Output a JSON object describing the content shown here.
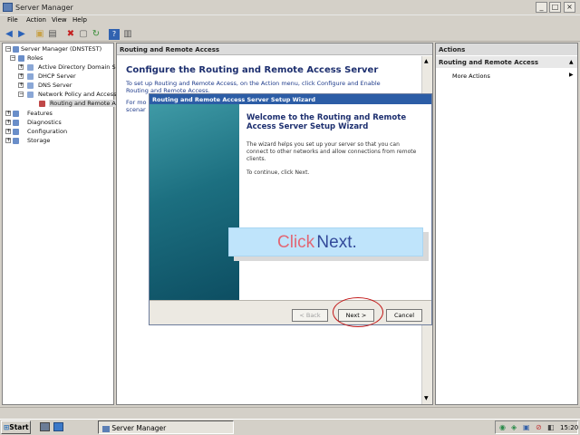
{
  "window": {
    "title": "Server Manager",
    "minimize": "_",
    "maximize": "□",
    "close": "×"
  },
  "menu": [
    "File",
    "Action",
    "View",
    "Help"
  ],
  "toolbar": {
    "icons": [
      "back-icon",
      "forward-icon",
      "up-icon",
      "show-hide-icon",
      "delete-icon",
      "properties-icon",
      "refresh-icon",
      "export-icon",
      "help-icon",
      "console-icon"
    ]
  },
  "tree": {
    "root": "Server Manager (DNSTEST)",
    "roles": "Roles",
    "role_items": [
      "Active Directory Domain Se",
      "DHCP Server",
      "DNS Server",
      "Network Policy and Access"
    ],
    "rra": "Routing and Remote Ac",
    "others": [
      "Features",
      "Diagnostics",
      "Configuration",
      "Storage"
    ]
  },
  "center": {
    "header": "Routing and Remote Access",
    "title": "Configure the Routing and Remote Access Server",
    "text1": "To set up Routing and Remote Access, on the Action menu, click Configure and Enable",
    "text1b": "Routing and Remote Access.",
    "text2a": "For mo",
    "text2b": "scenar"
  },
  "actions": {
    "header": "Actions",
    "section": "Routing and Remote Access",
    "item": "More Actions"
  },
  "wizard": {
    "title": "Routing and Remote Access Server Setup Wizard",
    "heading": "Welcome to the Routing and Remote Access Server Setup Wizard",
    "body": "The wizard helps you set up your server so that you can connect to other networks and allow connections from remote clients.",
    "continue": "To continue, click Next.",
    "back": "< Back",
    "next": "Next >",
    "cancel": "Cancel"
  },
  "overlay": {
    "word1": "Click",
    "word2": "Next."
  },
  "taskbar": {
    "start": "Start",
    "task": "Server Manager",
    "clock": "15:20"
  },
  "colors": {
    "accent": "#2c5da6",
    "annotation_circle": "#c21818"
  }
}
